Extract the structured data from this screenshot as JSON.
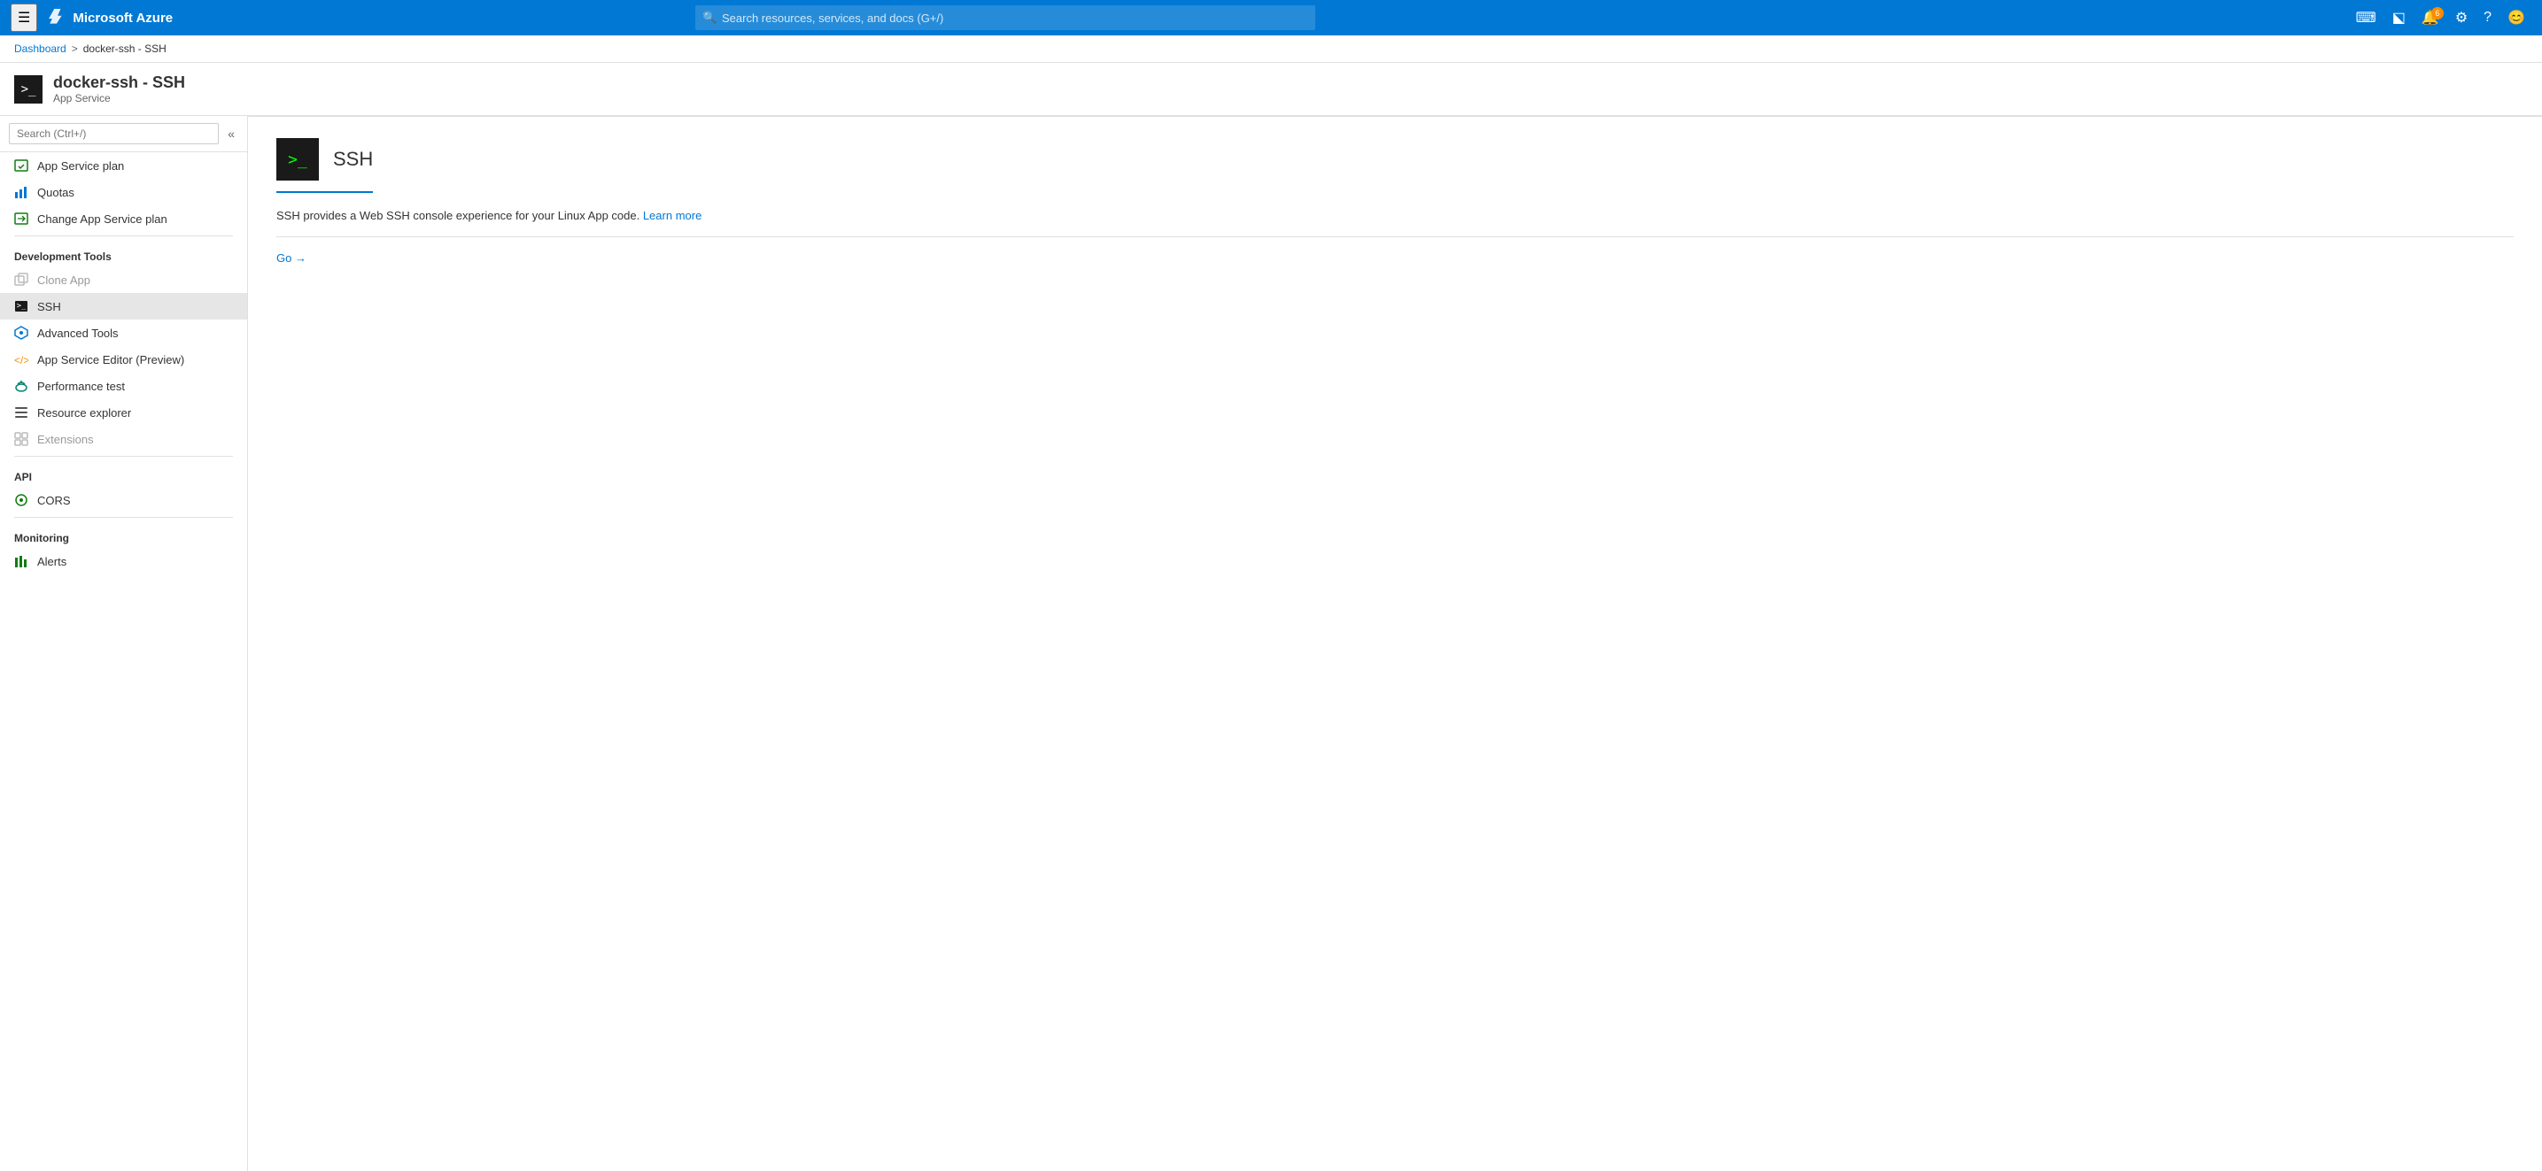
{
  "topnav": {
    "app_name": "Microsoft Azure",
    "search_placeholder": "Search resources, services, and docs (G+/)",
    "notification_count": "6"
  },
  "breadcrumb": {
    "home": "Dashboard",
    "separator": ">",
    "current": "docker-ssh - SSH"
  },
  "page_header": {
    "title": "docker-ssh - SSH",
    "subtitle": "App Service",
    "icon_text": ">_"
  },
  "sidebar": {
    "search_placeholder": "Search (Ctrl+/)",
    "collapse_symbol": "«",
    "items": [
      {
        "id": "app-service-plan",
        "label": "App Service plan",
        "icon": "📊",
        "icon_type": "chart",
        "disabled": false
      },
      {
        "id": "quotas",
        "label": "Quotas",
        "icon": "📈",
        "icon_type": "bar-chart",
        "disabled": false
      },
      {
        "id": "change-app-service-plan",
        "label": "Change App Service plan",
        "icon": "📋",
        "icon_type": "change",
        "disabled": false
      }
    ],
    "section_development": "Development Tools",
    "dev_items": [
      {
        "id": "clone-app",
        "label": "Clone App",
        "icon": "⊕",
        "icon_type": "clone",
        "disabled": true
      },
      {
        "id": "ssh",
        "label": "SSH",
        "icon": ">_",
        "icon_type": "terminal",
        "disabled": false,
        "active": true
      },
      {
        "id": "advanced-tools",
        "label": "Advanced Tools",
        "icon": "⚡",
        "icon_type": "kudu",
        "disabled": false
      },
      {
        "id": "app-service-editor",
        "label": "App Service Editor (Preview)",
        "icon": "</>",
        "icon_type": "editor",
        "disabled": false
      },
      {
        "id": "performance-test",
        "label": "Performance test",
        "icon": "☁",
        "icon_type": "cloud",
        "disabled": false
      },
      {
        "id": "resource-explorer",
        "label": "Resource explorer",
        "icon": "☰",
        "icon_type": "list",
        "disabled": false
      },
      {
        "id": "extensions",
        "label": "Extensions",
        "icon": "⊞",
        "icon_type": "extensions",
        "disabled": true
      }
    ],
    "section_api": "API",
    "api_items": [
      {
        "id": "cors",
        "label": "CORS",
        "icon": "●",
        "icon_type": "cors",
        "disabled": false
      }
    ],
    "section_monitoring": "Monitoring",
    "monitoring_items": [
      {
        "id": "alerts",
        "label": "Alerts",
        "icon": "📊",
        "icon_type": "alerts",
        "disabled": false
      }
    ]
  },
  "content": {
    "title": "SSH",
    "icon_text": ">_",
    "description_start": "SSH provides a Web SSH console experience for your Linux App code. ",
    "learn_more_label": "Learn more",
    "learn_more_url": "#",
    "go_label": "Go →"
  }
}
